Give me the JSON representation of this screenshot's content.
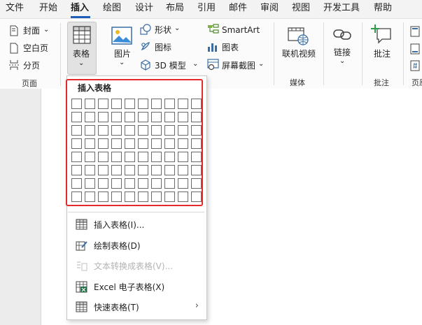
{
  "menu": {
    "tabs": [
      {
        "label": "文件"
      },
      {
        "label": "开始"
      },
      {
        "label": "插入",
        "active": true
      },
      {
        "label": "绘图"
      },
      {
        "label": "设计"
      },
      {
        "label": "布局"
      },
      {
        "label": "引用"
      },
      {
        "label": "邮件"
      },
      {
        "label": "审阅"
      },
      {
        "label": "视图"
      },
      {
        "label": "开发工具"
      },
      {
        "label": "帮助"
      }
    ]
  },
  "ribbon": {
    "pages_group": {
      "cover": "封面",
      "blank_page": "空白页",
      "page_break": "分页",
      "label": "页面"
    },
    "table_button": "表格",
    "illustrations": {
      "pictures": "图片",
      "shapes": "形状",
      "icons": "图标",
      "models_3d": "3D 模型",
      "smartart": "SmartArt",
      "chart": "图表",
      "screenshot": "屏幕截图"
    },
    "media": {
      "online_video": "联机视频",
      "label": "媒体"
    },
    "links": {
      "link": "链接"
    },
    "comments": {
      "comment": "批注",
      "label": "批注"
    },
    "header_footer_label": "页原"
  },
  "dropdown": {
    "grid_title": "插入表格",
    "grid_columns": 10,
    "grid_rows": 8,
    "items": [
      {
        "label": "插入表格(I)...",
        "icon": "table-icon",
        "enabled": true
      },
      {
        "label": "绘制表格(D)",
        "icon": "draw-table-icon",
        "enabled": true
      },
      {
        "label": "文本转换成表格(V)...",
        "icon": "convert-text-icon",
        "enabled": false
      },
      {
        "label": "Excel 电子表格(X)",
        "icon": "excel-icon",
        "enabled": true
      },
      {
        "label": "快速表格(T)",
        "icon": "quick-table-icon",
        "enabled": true,
        "submenu": true
      }
    ]
  },
  "colors": {
    "accent": "#1d5fb8",
    "highlight_border": "#e02c2c",
    "excel_green": "#1e7145"
  }
}
